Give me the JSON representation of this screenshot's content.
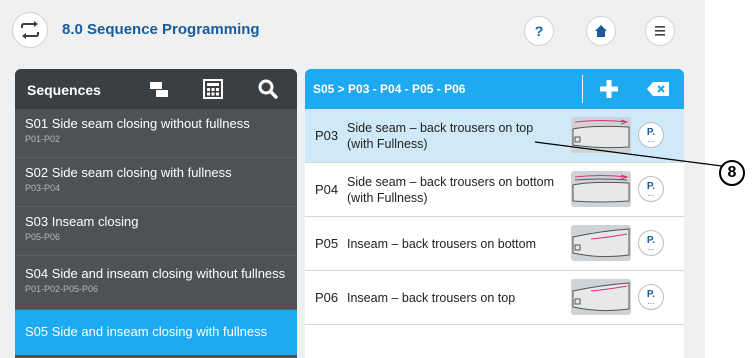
{
  "header": {
    "title": "8.0 Sequence Programming",
    "help_label": "?",
    "menu_icon": "hamburger-icon",
    "home_icon": "home-icon",
    "app_icon": "swap-arrows-icon"
  },
  "sequences": {
    "title": "Sequences",
    "items": [
      {
        "title": "S01  Side seam closing without fullness",
        "sub": "P01-P02"
      },
      {
        "title": "S02  Side seam closing with fullness",
        "sub": "P03-P04"
      },
      {
        "title": "S03  Inseam closing",
        "sub": "P05-P06"
      },
      {
        "title": "S04  Side and inseam closing without fullness",
        "sub": "P01-P02-P05-P06"
      },
      {
        "title": "S05  Side and inseam closing with fullness",
        "sub": ""
      }
    ]
  },
  "programs": {
    "breadcrumb": "S05 > P03 - P04 - P05 - P06",
    "items": [
      {
        "id": "P03",
        "name": "Side seam – back trousers on top (with Fullness)",
        "selected": true
      },
      {
        "id": "P04",
        "name": "Side seam – back trousers on bottom (with Fullness)",
        "selected": false
      },
      {
        "id": "P05",
        "name": "Inseam – back trousers on bottom",
        "selected": false
      },
      {
        "id": "P06",
        "name": "Inseam – back trousers on top",
        "selected": false
      }
    ],
    "param_button_label": "P.",
    "param_button_dots": "..."
  },
  "callout": {
    "label": "8"
  },
  "colors": {
    "accent": "#1eaaf1",
    "sidebar_bg": "#4d5256",
    "title_blue": "#1a5c99",
    "selected_row": "#cfe9f8"
  }
}
